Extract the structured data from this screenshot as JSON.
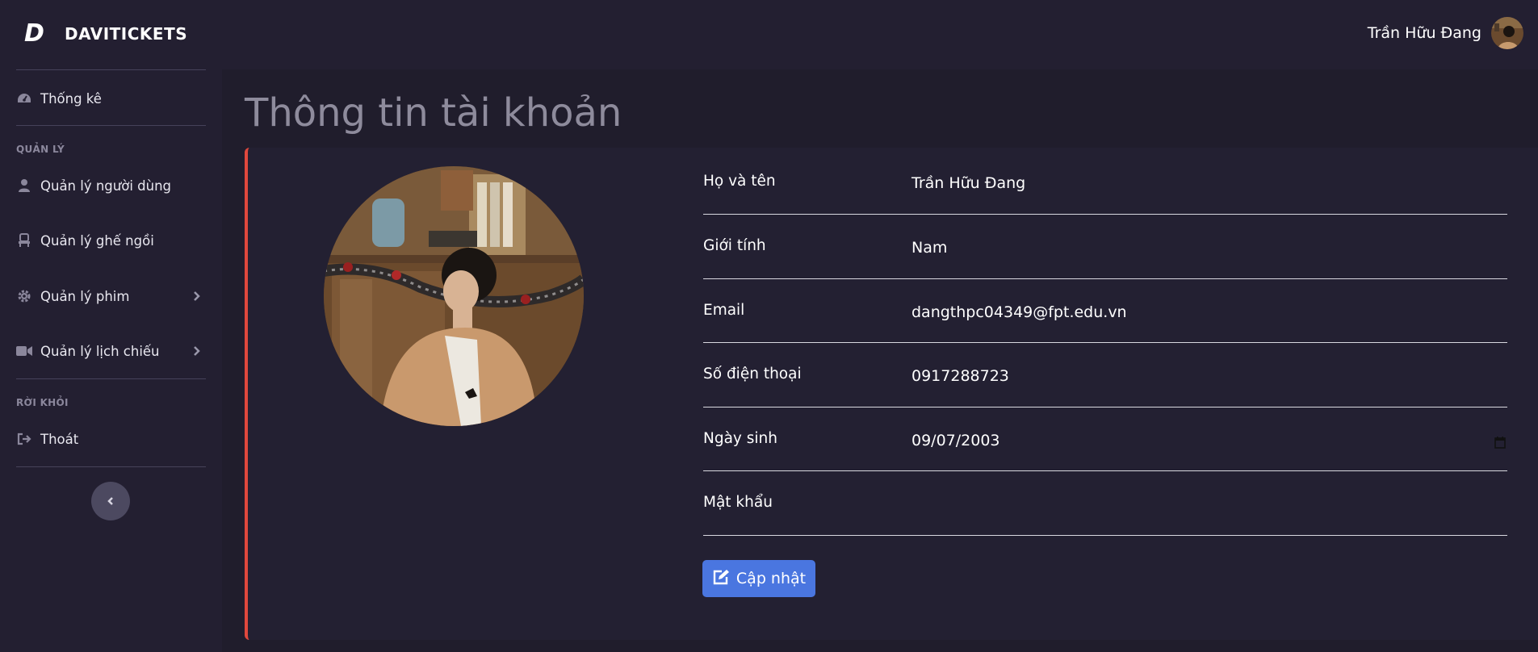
{
  "brand": {
    "logo": "D",
    "name": "DAVITICKETS"
  },
  "sidebar": {
    "dashboard_label": "Thống kê",
    "section_manage": "QUẢN LÝ",
    "items": [
      {
        "label": "Quản lý người dùng",
        "icon": "user-icon"
      },
      {
        "label": "Quản lý ghế ngồi",
        "icon": "seat-icon"
      },
      {
        "label": "Quản lý phim",
        "icon": "gear-icon"
      },
      {
        "label": "Quản lý lịch chiếu",
        "icon": "video-camera-icon"
      }
    ],
    "section_exit": "RỜI KHỎI",
    "logout_label": "Thoát"
  },
  "topbar": {
    "user_name": "Trần Hữu Đang"
  },
  "page": {
    "title": "Thông tin tài khoản"
  },
  "form": {
    "fields": [
      {
        "label": "Họ và tên",
        "value": "Trần Hữu Đang"
      },
      {
        "label": "Giới tính",
        "value": "Nam"
      },
      {
        "label": "Email",
        "value": "dangthpc04349@fpt.edu.vn"
      },
      {
        "label": "Số điện thoại",
        "value": "0917288723"
      },
      {
        "label": "Ngày sinh",
        "value": "09/07/2003"
      },
      {
        "label": "Mật khẩu",
        "value": ""
      }
    ],
    "submit_label": "Cập nhật"
  },
  "colors": {
    "background": "#231f31",
    "accent_border": "#e0483d",
    "button": "#4a76e0"
  }
}
